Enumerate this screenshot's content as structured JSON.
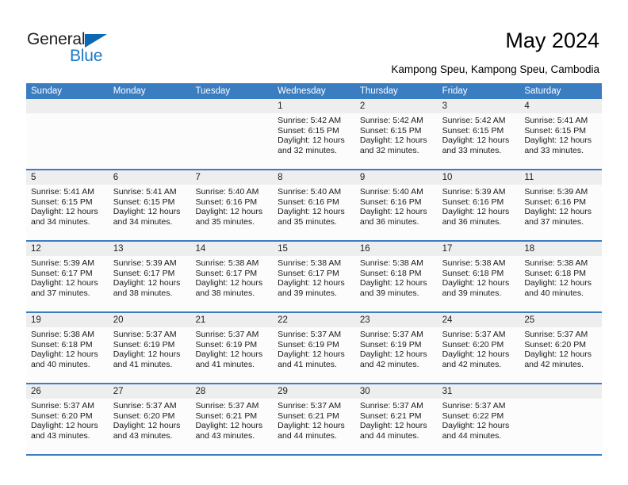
{
  "brand": {
    "name_part1": "General",
    "name_part2": "Blue",
    "triangle_color": "#0b68b3",
    "blue_color": "#1b79c8"
  },
  "header": {
    "title": "May 2024",
    "subtitle": "Kampong Speu, Kampong Speu, Cambodia"
  },
  "theme": {
    "header_blue": "#3b7dc1",
    "day_band_gray": "#eeeeee",
    "cell_white": "#fcfcfc"
  },
  "weekday_headers": [
    "Sunday",
    "Monday",
    "Tuesday",
    "Wednesday",
    "Thursday",
    "Friday",
    "Saturday"
  ],
  "weeks": [
    {
      "days": [
        {
          "num": "",
          "sunrise": "",
          "sunset": "",
          "daylight1": "",
          "daylight2": ""
        },
        {
          "num": "",
          "sunrise": "",
          "sunset": "",
          "daylight1": "",
          "daylight2": ""
        },
        {
          "num": "",
          "sunrise": "",
          "sunset": "",
          "daylight1": "",
          "daylight2": ""
        },
        {
          "num": "1",
          "sunrise": "Sunrise: 5:42 AM",
          "sunset": "Sunset: 6:15 PM",
          "daylight1": "Daylight: 12 hours",
          "daylight2": "and 32 minutes."
        },
        {
          "num": "2",
          "sunrise": "Sunrise: 5:42 AM",
          "sunset": "Sunset: 6:15 PM",
          "daylight1": "Daylight: 12 hours",
          "daylight2": "and 32 minutes."
        },
        {
          "num": "3",
          "sunrise": "Sunrise: 5:42 AM",
          "sunset": "Sunset: 6:15 PM",
          "daylight1": "Daylight: 12 hours",
          "daylight2": "and 33 minutes."
        },
        {
          "num": "4",
          "sunrise": "Sunrise: 5:41 AM",
          "sunset": "Sunset: 6:15 PM",
          "daylight1": "Daylight: 12 hours",
          "daylight2": "and 33 minutes."
        }
      ]
    },
    {
      "days": [
        {
          "num": "5",
          "sunrise": "Sunrise: 5:41 AM",
          "sunset": "Sunset: 6:15 PM",
          "daylight1": "Daylight: 12 hours",
          "daylight2": "and 34 minutes."
        },
        {
          "num": "6",
          "sunrise": "Sunrise: 5:41 AM",
          "sunset": "Sunset: 6:15 PM",
          "daylight1": "Daylight: 12 hours",
          "daylight2": "and 34 minutes."
        },
        {
          "num": "7",
          "sunrise": "Sunrise: 5:40 AM",
          "sunset": "Sunset: 6:16 PM",
          "daylight1": "Daylight: 12 hours",
          "daylight2": "and 35 minutes."
        },
        {
          "num": "8",
          "sunrise": "Sunrise: 5:40 AM",
          "sunset": "Sunset: 6:16 PM",
          "daylight1": "Daylight: 12 hours",
          "daylight2": "and 35 minutes."
        },
        {
          "num": "9",
          "sunrise": "Sunrise: 5:40 AM",
          "sunset": "Sunset: 6:16 PM",
          "daylight1": "Daylight: 12 hours",
          "daylight2": "and 36 minutes."
        },
        {
          "num": "10",
          "sunrise": "Sunrise: 5:39 AM",
          "sunset": "Sunset: 6:16 PM",
          "daylight1": "Daylight: 12 hours",
          "daylight2": "and 36 minutes."
        },
        {
          "num": "11",
          "sunrise": "Sunrise: 5:39 AM",
          "sunset": "Sunset: 6:16 PM",
          "daylight1": "Daylight: 12 hours",
          "daylight2": "and 37 minutes."
        }
      ]
    },
    {
      "days": [
        {
          "num": "12",
          "sunrise": "Sunrise: 5:39 AM",
          "sunset": "Sunset: 6:17 PM",
          "daylight1": "Daylight: 12 hours",
          "daylight2": "and 37 minutes."
        },
        {
          "num": "13",
          "sunrise": "Sunrise: 5:39 AM",
          "sunset": "Sunset: 6:17 PM",
          "daylight1": "Daylight: 12 hours",
          "daylight2": "and 38 minutes."
        },
        {
          "num": "14",
          "sunrise": "Sunrise: 5:38 AM",
          "sunset": "Sunset: 6:17 PM",
          "daylight1": "Daylight: 12 hours",
          "daylight2": "and 38 minutes."
        },
        {
          "num": "15",
          "sunrise": "Sunrise: 5:38 AM",
          "sunset": "Sunset: 6:17 PM",
          "daylight1": "Daylight: 12 hours",
          "daylight2": "and 39 minutes."
        },
        {
          "num": "16",
          "sunrise": "Sunrise: 5:38 AM",
          "sunset": "Sunset: 6:18 PM",
          "daylight1": "Daylight: 12 hours",
          "daylight2": "and 39 minutes."
        },
        {
          "num": "17",
          "sunrise": "Sunrise: 5:38 AM",
          "sunset": "Sunset: 6:18 PM",
          "daylight1": "Daylight: 12 hours",
          "daylight2": "and 39 minutes."
        },
        {
          "num": "18",
          "sunrise": "Sunrise: 5:38 AM",
          "sunset": "Sunset: 6:18 PM",
          "daylight1": "Daylight: 12 hours",
          "daylight2": "and 40 minutes."
        }
      ]
    },
    {
      "days": [
        {
          "num": "19",
          "sunrise": "Sunrise: 5:38 AM",
          "sunset": "Sunset: 6:18 PM",
          "daylight1": "Daylight: 12 hours",
          "daylight2": "and 40 minutes."
        },
        {
          "num": "20",
          "sunrise": "Sunrise: 5:37 AM",
          "sunset": "Sunset: 6:19 PM",
          "daylight1": "Daylight: 12 hours",
          "daylight2": "and 41 minutes."
        },
        {
          "num": "21",
          "sunrise": "Sunrise: 5:37 AM",
          "sunset": "Sunset: 6:19 PM",
          "daylight1": "Daylight: 12 hours",
          "daylight2": "and 41 minutes."
        },
        {
          "num": "22",
          "sunrise": "Sunrise: 5:37 AM",
          "sunset": "Sunset: 6:19 PM",
          "daylight1": "Daylight: 12 hours",
          "daylight2": "and 41 minutes."
        },
        {
          "num": "23",
          "sunrise": "Sunrise: 5:37 AM",
          "sunset": "Sunset: 6:19 PM",
          "daylight1": "Daylight: 12 hours",
          "daylight2": "and 42 minutes."
        },
        {
          "num": "24",
          "sunrise": "Sunrise: 5:37 AM",
          "sunset": "Sunset: 6:20 PM",
          "daylight1": "Daylight: 12 hours",
          "daylight2": "and 42 minutes."
        },
        {
          "num": "25",
          "sunrise": "Sunrise: 5:37 AM",
          "sunset": "Sunset: 6:20 PM",
          "daylight1": "Daylight: 12 hours",
          "daylight2": "and 42 minutes."
        }
      ]
    },
    {
      "days": [
        {
          "num": "26",
          "sunrise": "Sunrise: 5:37 AM",
          "sunset": "Sunset: 6:20 PM",
          "daylight1": "Daylight: 12 hours",
          "daylight2": "and 43 minutes."
        },
        {
          "num": "27",
          "sunrise": "Sunrise: 5:37 AM",
          "sunset": "Sunset: 6:20 PM",
          "daylight1": "Daylight: 12 hours",
          "daylight2": "and 43 minutes."
        },
        {
          "num": "28",
          "sunrise": "Sunrise: 5:37 AM",
          "sunset": "Sunset: 6:21 PM",
          "daylight1": "Daylight: 12 hours",
          "daylight2": "and 43 minutes."
        },
        {
          "num": "29",
          "sunrise": "Sunrise: 5:37 AM",
          "sunset": "Sunset: 6:21 PM",
          "daylight1": "Daylight: 12 hours",
          "daylight2": "and 44 minutes."
        },
        {
          "num": "30",
          "sunrise": "Sunrise: 5:37 AM",
          "sunset": "Sunset: 6:21 PM",
          "daylight1": "Daylight: 12 hours",
          "daylight2": "and 44 minutes."
        },
        {
          "num": "31",
          "sunrise": "Sunrise: 5:37 AM",
          "sunset": "Sunset: 6:22 PM",
          "daylight1": "Daylight: 12 hours",
          "daylight2": "and 44 minutes."
        },
        {
          "num": "",
          "sunrise": "",
          "sunset": "",
          "daylight1": "",
          "daylight2": ""
        }
      ]
    }
  ]
}
